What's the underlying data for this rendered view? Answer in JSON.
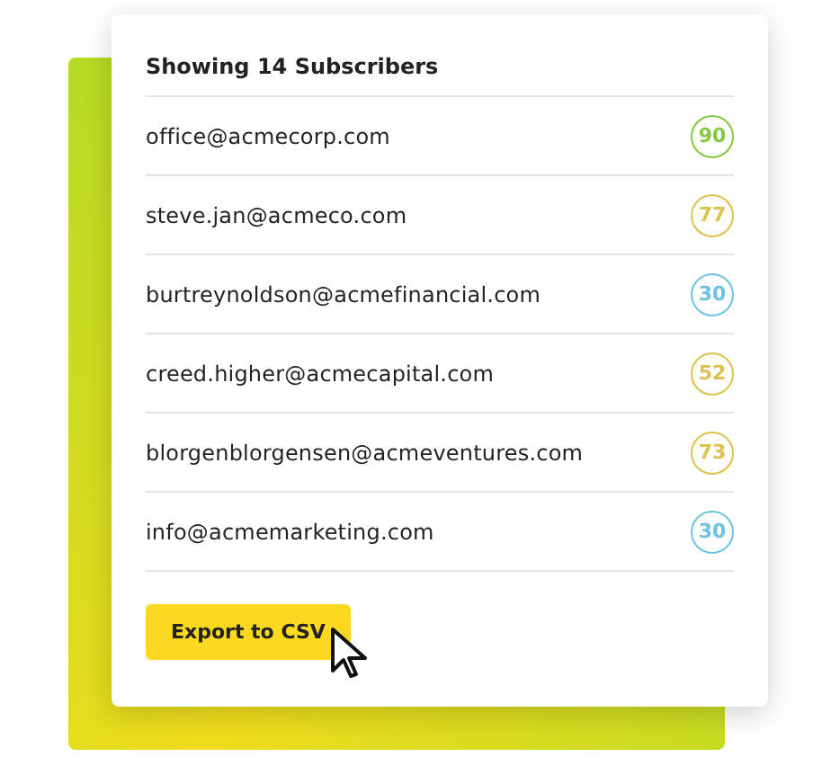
{
  "header": "Showing 14 Subscribers",
  "subscribers": [
    {
      "email": "office@acmecorp.com",
      "score": "90",
      "color": "#86c940"
    },
    {
      "email": "steve.jan@acmeco.com",
      "score": "77",
      "color": "#dcc24e"
    },
    {
      "email": "burtreynoldson@acmefinancial.com",
      "score": "30",
      "color": "#6cc3df"
    },
    {
      "email": "creed.higher@acmecapital.com",
      "score": "52",
      "color": "#dcc24e"
    },
    {
      "email": "blorgenblorgensen@acmeventures.com",
      "score": "73",
      "color": "#dcc24e"
    },
    {
      "email": "info@acmemarketing.com",
      "score": "30",
      "color": "#6cc3df"
    }
  ],
  "export_button": "Export to CSV"
}
